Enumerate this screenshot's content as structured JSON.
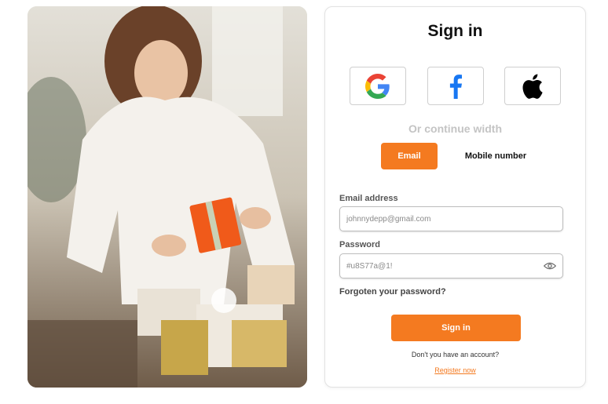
{
  "photo": {
    "description_icon": "photo-woman-gifts"
  },
  "card": {
    "title": "Sign in",
    "social": [
      {
        "name": "google",
        "icon": "google-icon"
      },
      {
        "name": "facebook",
        "icon": "facebook-icon"
      },
      {
        "name": "apple",
        "icon": "apple-icon"
      }
    ],
    "divider_text": "Or continue width",
    "tabs": {
      "email": "Email",
      "mobile": "Mobile number",
      "active": "Email"
    },
    "email_label": "Email address",
    "email_placeholder": "johnnydepp@gmail.com",
    "password_label": "Password",
    "password_placeholder": "#u8S77a@1!",
    "forgot": "Forgoten your password?",
    "submit": "Sign in",
    "no_account": "Don't you have an account?",
    "register": "Register now"
  },
  "colors": {
    "accent": "#f47a20",
    "facebook": "#1877f2",
    "apple": "#000000"
  }
}
